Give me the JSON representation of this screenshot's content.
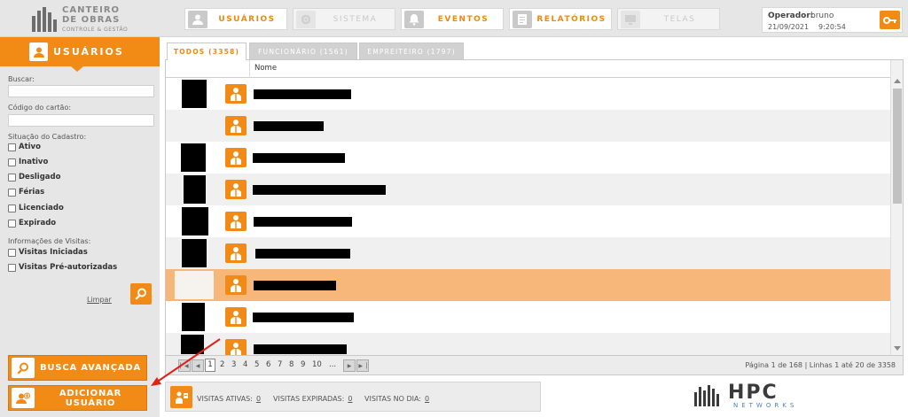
{
  "brand": {
    "line1": "CANTEIRO",
    "line2": "DE OBRAS",
    "line3": "CONTROLE & GESTÃO"
  },
  "topnav": [
    {
      "label": "USUÁRIOS",
      "icon": "user-icon",
      "enabled": true
    },
    {
      "label": "SISTEMA",
      "icon": "gear-icon",
      "enabled": false
    },
    {
      "label": "EVENTOS",
      "icon": "bell-icon",
      "enabled": true
    },
    {
      "label": "RELATÓRIOS",
      "icon": "report-icon",
      "enabled": true
    },
    {
      "label": "TELAS",
      "icon": "monitor-icon",
      "enabled": false
    }
  ],
  "operator": {
    "label": "Operador:",
    "name": "bruno",
    "date": "21/09/2021",
    "time": "9:20:54"
  },
  "sidebar": {
    "title": "USUÁRIOS",
    "search_label": "Buscar:",
    "search_value": "",
    "card_label": "Código do cartão:",
    "card_value": "",
    "status_label": "Situação do Cadastro:",
    "status_options": [
      {
        "label": "Ativo",
        "checked": false
      },
      {
        "label": "Inativo",
        "checked": false
      },
      {
        "label": "Desligado",
        "checked": false
      },
      {
        "label": "Férias",
        "checked": false
      },
      {
        "label": "Licenciado",
        "checked": false
      },
      {
        "label": "Expirado",
        "checked": false
      }
    ],
    "visits_label": "Informações de Visitas:",
    "visits_options": [
      {
        "label": "Visitas Iniciadas",
        "checked": false
      },
      {
        "label": "Visitas Pré-autorizadas",
        "checked": false
      }
    ],
    "clear_label": "Limpar",
    "advanced_search_label": "BUSCA AVANÇADA",
    "add_user_label": "ADICIONAR USUÁRIO"
  },
  "tabs": [
    {
      "label": "TODOS (3358)",
      "active": true
    },
    {
      "label": "FUNCIONÁRIO (1561)",
      "active": false
    },
    {
      "label": "EMPREITEIRO (1797)",
      "active": false
    }
  ],
  "grid": {
    "column_name": "Nome",
    "rows": [
      {
        "selected": false
      },
      {
        "selected": false
      },
      {
        "selected": false
      },
      {
        "selected": false
      },
      {
        "selected": false
      },
      {
        "selected": false
      },
      {
        "selected": true
      },
      {
        "selected": false
      },
      {
        "selected": false
      }
    ]
  },
  "pager": {
    "pages": [
      "1",
      "2",
      "3",
      "4",
      "5",
      "6",
      "7",
      "8",
      "9",
      "10",
      "..."
    ],
    "current": "1",
    "info": "Página 1 de 168 | Linhas 1 até 20 de 3358"
  },
  "footer": {
    "active_label": "VISITAS ATIVAS:",
    "active_value": "0",
    "expired_label": "VISITAS EXPIRADAS:",
    "expired_value": "0",
    "day_label": "VISITAS NO DIA:",
    "day_value": "0"
  },
  "partner_logo": {
    "text": "HPC",
    "sub": "NETWORKS"
  },
  "colors": {
    "accent": "#f28a16",
    "selected_row": "#f7b77a",
    "annotation": "#e0201b"
  }
}
